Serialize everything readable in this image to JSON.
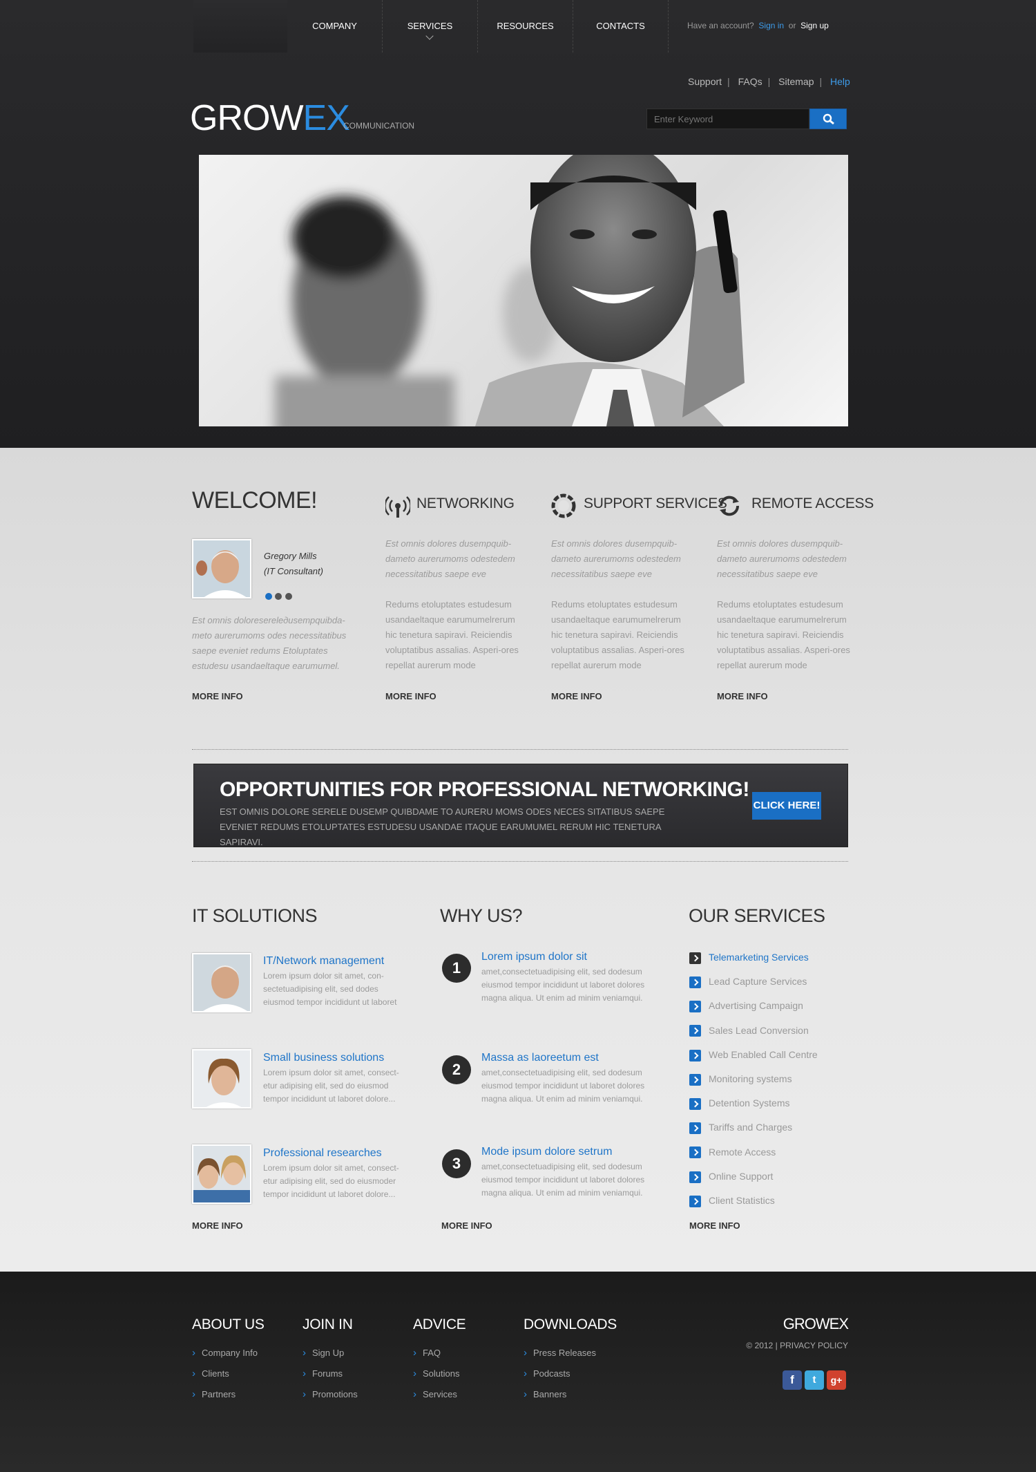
{
  "nav": {
    "items": [
      "COMPANY",
      "SERVICES",
      "RESOURCES",
      "CONTACTS"
    ]
  },
  "account": {
    "prompt": "Have an account?",
    "signin": "Sign in",
    "or": "or",
    "signup": "Sign up"
  },
  "toplinks": {
    "support": "Support",
    "faqs": "FAQs",
    "sitemap": "Sitemap",
    "help": "Help"
  },
  "brand": {
    "name_a": "GROW",
    "name_b": "EX",
    "tagline": "COMMUNICATION"
  },
  "search": {
    "placeholder": "Enter Keyword"
  },
  "welcome": {
    "title": "WELCOME!",
    "person_name": "Gregory Mills",
    "person_role": "(IT Consultant)",
    "text": "Est omnis doloreserelедusempquibda-meto aurerumoms odes necessitatibus saepe eveniet redums Etoluptates estudesu usandaeltaque earumumel.",
    "more": "MORE INFO"
  },
  "features": [
    {
      "title": "NETWORKING",
      "lead": "Est omnis dolores dusempquib-dameto aurerumoms odestedem necessitatibus saepe eve",
      "body": "Redums etoluptates estudesum usandaeltaque earumumelrerum hic tenetura sapiravi. Reiciendis voluptatibus assalias. Asperi-ores repellat aurerum mode",
      "more": "MORE INFO"
    },
    {
      "title": "SUPPORT SERVICES",
      "lead": "Est omnis dolores dusempquib-dameto aurerumoms odestedem necessitatibus saepe eve",
      "body": "Redums etoluptates estudesum usandaeltaque earumumelrerum hic tenetura sapiravi. Reiciendis voluptatibus assalias. Asperi-ores repellat aurerum mode",
      "more": "MORE INFO"
    },
    {
      "title": "REMOTE ACCESS",
      "lead": "Est omnis dolores dusempquib-dameto aurerumoms odestedem necessitatibus saepe eve",
      "body": "Redums etoluptates estudesum usandaeltaque earumumelrerum hic tenetura sapiravi. Reiciendis voluptatibus assalias. Asperi-ores repellat aurerum mode",
      "more": "MORE INFO"
    }
  ],
  "promo": {
    "title": "OPPORTUNITIES FOR PROFESSIONAL NETWORKING!",
    "sub": "EST OMNIS DOLORE SERELE DUSEMP QUIBDAME TO AURERU MOMS ODES NECES SITATIBUS SAEPE EVENIET REDUMS ETOLUPTATES ESTUDESU USANDAE ITAQUE EARUMUMEL RERUM HIC TENETURA SAPIRAVI.",
    "button": "CLICK HERE!"
  },
  "it_solutions": {
    "title": "IT SOLUTIONS",
    "more": "MORE INFO",
    "items": [
      {
        "title": "IT/Network management",
        "text": "Lorem ipsum dolor sit amet, con-sectetuadipising elit, sed dodes eiusmod tempor incididunt ut laboret"
      },
      {
        "title": "Small business solutions",
        "text": "Lorem ipsum dolor sit amet, consect-etur adipising elit, sed do eiusmod tempor incididunt ut laboret dolore..."
      },
      {
        "title": "Professional researches",
        "text": "Lorem ipsum dolor sit amet, consect-etur adipising elit, sed do eiusmoder tempor incididunt ut laboret dolore..."
      }
    ]
  },
  "why_us": {
    "title": "WHY US?",
    "more": "MORE INFO",
    "items": [
      {
        "num": "1",
        "title": "Lorem ipsum dolor sit",
        "text": "amet,consectetuadipising elit, sed dodesum eiusmod tempor incididunt ut laboret dolores magna aliqua. Ut enim ad minim veniamqui."
      },
      {
        "num": "2",
        "title": "Massa as laoreetum est",
        "text": "amet,consectetuadipising elit, sed dodesum eiusmod tempor incididunt ut laboret dolores magna aliqua. Ut enim ad minim veniamqui."
      },
      {
        "num": "3",
        "title": "Mode ipsum dolore setrum",
        "text": "amet,consectetuadipising elit, sed dodesum eiusmod tempor incididunt ut laboret dolores magna aliqua. Ut enim ad minim veniamqui."
      }
    ]
  },
  "our_services": {
    "title": "OUR SERVICES",
    "more": "MORE INFO",
    "items": [
      "Telemarketing Services",
      "Lead Capture Services",
      "Advertising Campaign",
      "Sales Lead Conversion",
      "Web Enabled Call Centre",
      "Monitoring systems",
      "Detention Systems",
      "Tariffs and Charges",
      "Remote Access",
      "Online Support",
      "Client Statistics"
    ]
  },
  "footer": {
    "cols": [
      {
        "title": "ABOUT US",
        "links": [
          "Company Info",
          "Clients",
          "Partners"
        ]
      },
      {
        "title": "JOIN IN",
        "links": [
          "Sign Up",
          "Forums",
          "Promotions"
        ]
      },
      {
        "title": "ADVICE",
        "links": [
          "FAQ",
          "Solutions",
          "Services"
        ]
      },
      {
        "title": "DOWNLOADS",
        "links": [
          "Press Releases",
          "Podcasts",
          "Banners"
        ]
      }
    ],
    "logo": "GROWEX",
    "copyright": "© 2012 | PRIVACY POLICY",
    "social": [
      "facebook-icon",
      "twitter-icon",
      "google-plus-icon"
    ]
  },
  "colors": {
    "accent": "#1a6fc4",
    "dark": "#2b2b2d"
  }
}
